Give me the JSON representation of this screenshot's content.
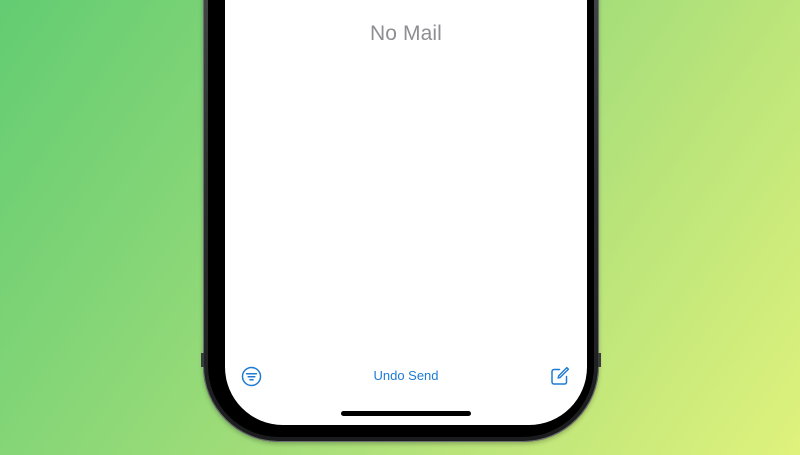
{
  "mailbox": {
    "empty_message": "No Mail"
  },
  "toolbar": {
    "filter_icon": "filter-circle-icon",
    "undo_send_label": "Undo Send",
    "compose_icon": "compose-icon"
  },
  "colors": {
    "accent": "#1e7ad2",
    "empty_text": "#8e8e93",
    "background_start": "#63cc72",
    "background_end": "#dff27c"
  }
}
